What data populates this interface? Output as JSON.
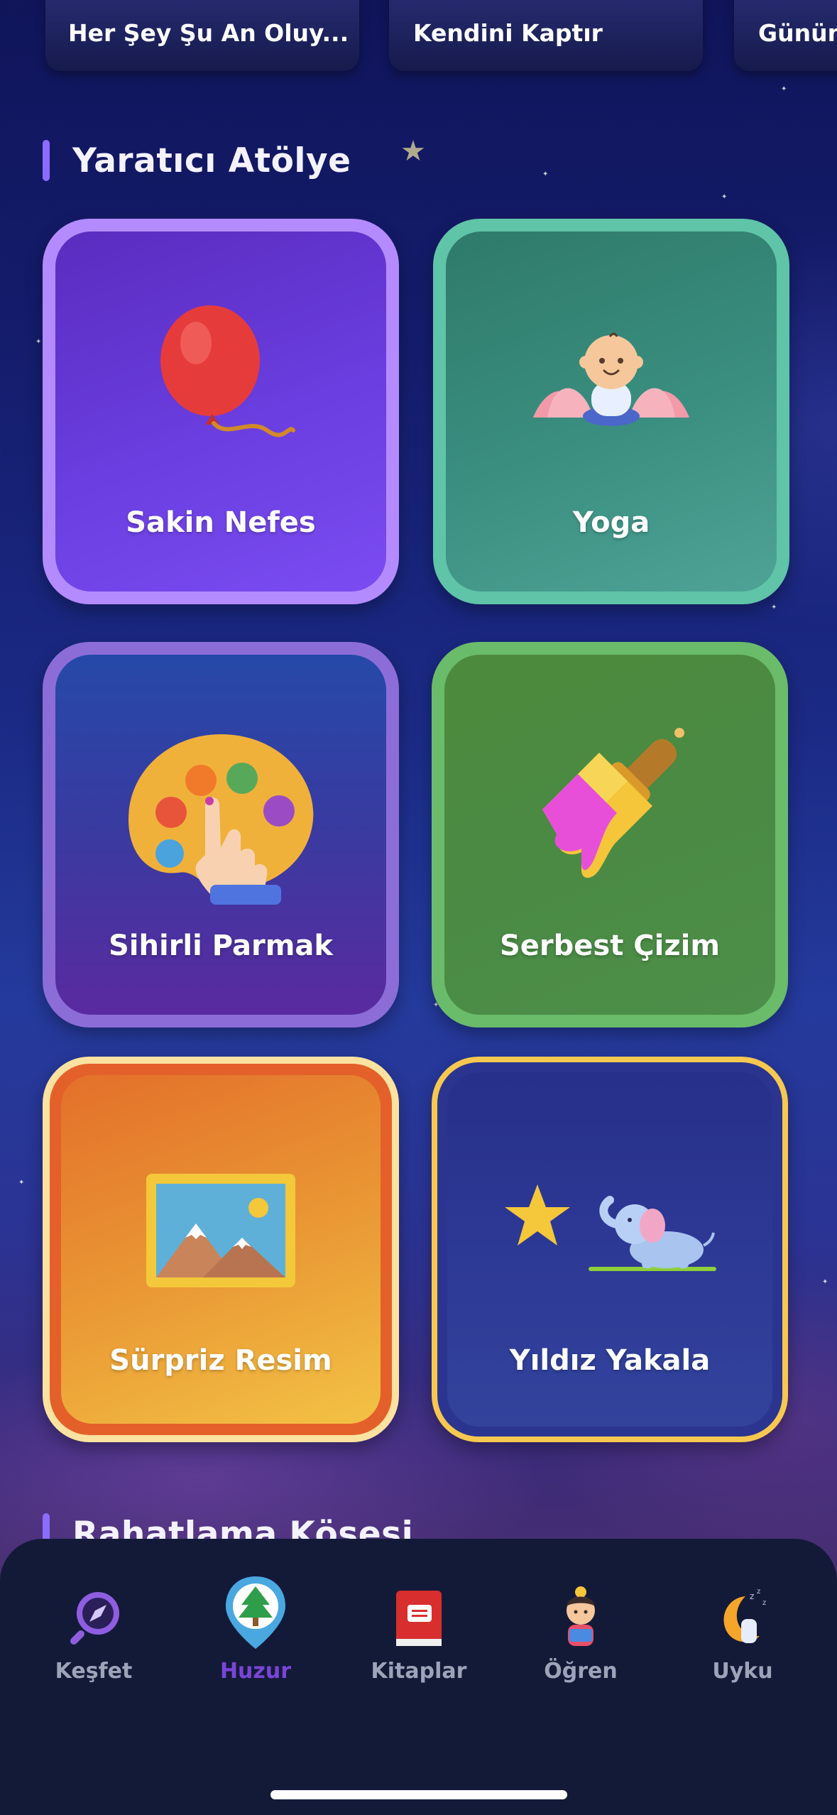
{
  "carousel": {
    "cards": [
      {
        "label": "Her Şey Şu An Oluy..."
      },
      {
        "label": "Kendini Kaptır"
      },
      {
        "label": "Günün"
      }
    ]
  },
  "sections": {
    "creative": {
      "title": "Yaratıcı Atölye"
    },
    "relax": {
      "title": "Rahatlama Köşesi"
    }
  },
  "activities": [
    {
      "label": "Sakin Nefes",
      "icon": "balloon-icon"
    },
    {
      "label": "Yoga",
      "icon": "baby-lotus-icon"
    },
    {
      "label": "Sihirli Parmak",
      "icon": "palette-finger-icon"
    },
    {
      "label": "Serbest Çizim",
      "icon": "paintbrush-icon"
    },
    {
      "label": "Sürpriz Resim",
      "icon": "picture-frame-icon"
    },
    {
      "label": "Yıldız Yakala",
      "icon": "star-elephant-icon"
    }
  ],
  "nav": {
    "items": [
      {
        "label": "Keşfet",
        "icon": "explore-icon"
      },
      {
        "label": "Huzur",
        "icon": "tree-pin-icon",
        "active": true
      },
      {
        "label": "Kitaplar",
        "icon": "book-icon"
      },
      {
        "label": "Öğren",
        "icon": "learning-child-icon"
      },
      {
        "label": "Uyku",
        "icon": "moon-sleep-icon"
      }
    ]
  },
  "colors": {
    "accent": "#8b6cff",
    "nav_active": "#7a45d6",
    "nav_inactive": "#9da3b8",
    "nav_background": "#131a38"
  }
}
